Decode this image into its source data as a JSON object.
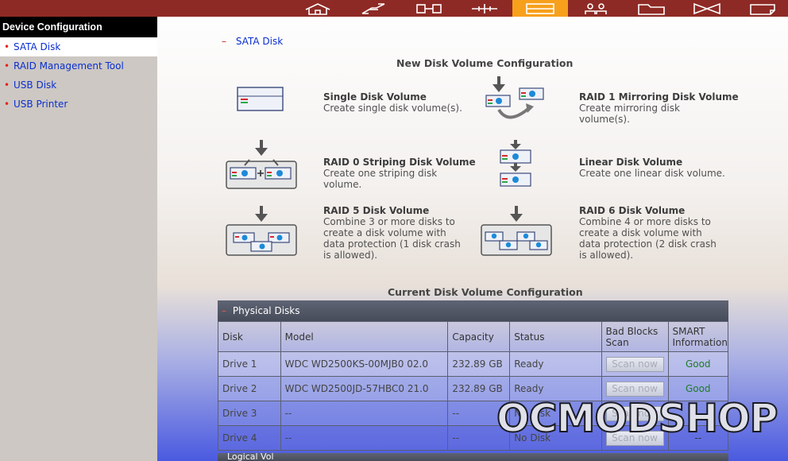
{
  "topnav": {
    "icons": [
      "home-icon",
      "network-icon",
      "device-icon",
      "system-tools-icon",
      "disk-management-icon",
      "users-icon",
      "folder-icon",
      "transfer-icon",
      "status-icon"
    ],
    "active_index": 4
  },
  "sidebar": {
    "title": "Device Configuration",
    "items": [
      {
        "label": "SATA Disk",
        "selected": true
      },
      {
        "label": "RAID Management Tool"
      },
      {
        "label": "USB Disk"
      },
      {
        "label": "USB Printer"
      }
    ]
  },
  "breadcrumb": {
    "dash": "–",
    "label": "SATA Disk"
  },
  "new_config": {
    "title": "New Disk Volume Configuration",
    "volumes": [
      {
        "title": "Single Disk Volume",
        "desc": "Create single disk volume(s)."
      },
      {
        "title": "RAID 1 Mirroring Disk Volume",
        "desc": "Create mirroring disk volume(s)."
      },
      {
        "title": "RAID 0 Striping Disk Volume",
        "desc": "Create one striping disk volume."
      },
      {
        "title": "Linear Disk Volume",
        "desc": "Create one linear disk volume."
      },
      {
        "title": "RAID 5 Disk Volume",
        "desc": "Combine 3 or more disks to create a disk volume with data protection (1 disk crash is allowed)."
      },
      {
        "title": "RAID 6 Disk Volume",
        "desc": "Combine 4 or more disks to create a disk volume with data protection (2 disk crash is allowed)."
      }
    ]
  },
  "current_config": {
    "title": "Current Disk Volume Configuration",
    "physical_disks_label": "Physical Disks",
    "columns": [
      "Disk",
      "Model",
      "Capacity",
      "Status",
      "Bad Blocks Scan",
      "SMART Information"
    ],
    "rows": [
      {
        "disk": "Drive 1",
        "model": "WDC WD2500KS-00MJB0 02.0",
        "capacity": "232.89 GB",
        "status": "Ready",
        "scan": "Scan now",
        "smart": "Good"
      },
      {
        "disk": "Drive 2",
        "model": "WDC WD2500JD-57HBC0 21.0",
        "capacity": "232.89 GB",
        "status": "Ready",
        "scan": "Scan now",
        "smart": "Good"
      },
      {
        "disk": "Drive 3",
        "model": "--",
        "capacity": "--",
        "status": "No Disk",
        "scan": "Scan now",
        "smart": "--"
      },
      {
        "disk": "Drive 4",
        "model": "--",
        "capacity": "--",
        "status": "No Disk",
        "scan": "Scan now",
        "smart": "--"
      }
    ],
    "logical_label": "Logical Vol"
  },
  "watermark": "OCMODSHOP",
  "colors": {
    "topbar": "#8e2a25",
    "active_tab": "#f7a01c",
    "link": "#0b2fd0",
    "bullet": "#e4231b",
    "smart_good": "#1f7a2a"
  }
}
